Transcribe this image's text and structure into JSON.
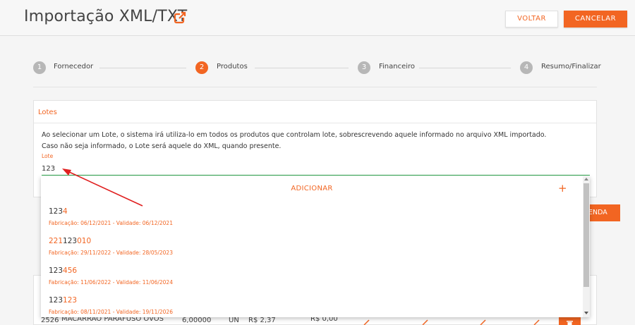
{
  "header": {
    "title": "Importação XML/TXT",
    "voltar_label": "VOLTAR",
    "cancelar_label": "CANCELAR",
    "external_icon": "external-link-icon"
  },
  "stepper": {
    "steps": [
      {
        "number": "1",
        "label": "Fornecedor",
        "active": false
      },
      {
        "number": "2",
        "label": "Produtos",
        "active": true
      },
      {
        "number": "3",
        "label": "Financeiro",
        "active": false
      },
      {
        "number": "4",
        "label": "Resumo/Finalizar",
        "active": false
      }
    ]
  },
  "lotes": {
    "title": "Lotes",
    "description_line1": "Ao selecionar um Lote, o sistema irá utiliza-lo em todos os produtos que controlam lote, sobrescrevendo aquele informado no arquivo XML importado.",
    "description_line2": "Caso não seja informado, o Lote será aquele do XML, quando presente.",
    "field_label": "Lote",
    "field_value": "123"
  },
  "dropdown": {
    "add_label": "ADICIONAR",
    "add_icon": "+",
    "options": [
      {
        "pre": "",
        "match": "123",
        "post": "4",
        "info": "Fabricação: 06/12/2021 - Validade: 06/12/2021"
      },
      {
        "pre": "221",
        "match": "123",
        "post": "010",
        "info": "Fabricação: 29/11/2022 - Validade: 28/05/2023"
      },
      {
        "pre": "",
        "match": "123",
        "post": "456",
        "info": "Fabricação: 11/06/2022 - Validade: 11/06/2024"
      },
      {
        "pre": "",
        "match": "123",
        "post": "123",
        "info": "Fabricação: 08/11/2021 - Validade: 19/11/2026"
      }
    ]
  },
  "background": {
    "button_partial": "ENDA",
    "row": {
      "code": "2526",
      "description": "MACARRAO PARAFUSO OVOS",
      "quantity": "6,00000",
      "unit": "UN",
      "price": "R$ 2,37",
      "total": "R$ 0,00"
    }
  },
  "colors": {
    "accent": "#f26522",
    "input_underline": "#2fa84f",
    "arrow": "#e02020"
  }
}
